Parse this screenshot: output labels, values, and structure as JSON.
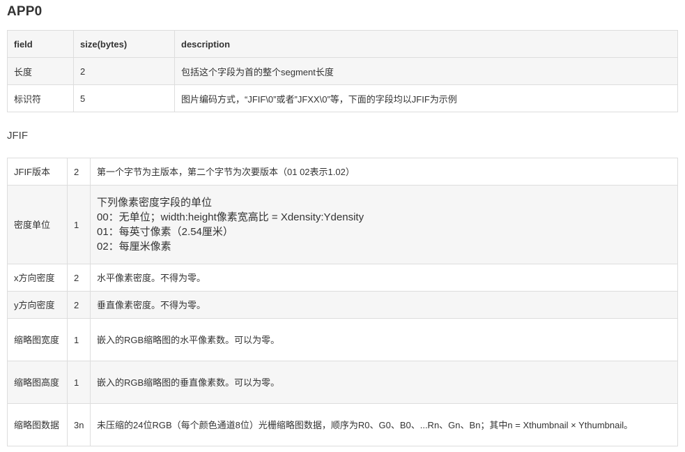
{
  "app0": {
    "title": "APP0",
    "headers": [
      "field",
      "size(bytes)",
      "description"
    ],
    "rows": [
      {
        "field": "长度",
        "size": "2",
        "description": "包括这个字段为首的整个segment长度"
      },
      {
        "field": "标识符",
        "size": "5",
        "description": "图片编码方式，“JFIF\\0”或者”JFXX\\0”等，下面的字段均以JFIF为示例"
      }
    ]
  },
  "jfif": {
    "title": "JFIF",
    "rows": [
      {
        "field": "JFIF版本",
        "size": "2",
        "description": "第一个字节为主版本，第二个字节为次要版本（01 02表示1.02）"
      },
      {
        "field": "密度单位",
        "size": "1",
        "description_lines": [
          "下列像素密度字段的单位",
          "00：无单位；width:height像素宽高比 = Xdensity:Ydensity",
          "01：每英寸像素（2.54厘米）",
          "02：每厘米像素"
        ]
      },
      {
        "field": "x方向密度",
        "size": "2",
        "description": "水平像素密度。不得为零。"
      },
      {
        "field": "y方向密度",
        "size": "2",
        "description": "垂直像素密度。不得为零。"
      },
      {
        "field": "缩略图宽度",
        "size": "1",
        "description": "嵌入的RGB缩略图的水平像素数。可以为零。"
      },
      {
        "field": "缩略图高度",
        "size": "1",
        "description": "嵌入的RGB缩略图的垂直像素数。可以为零。"
      },
      {
        "field": "缩略图数据",
        "size": "3n",
        "description": "未压缩的24位RGB（每个颜色通道8位）光栅缩略图数据，顺序为R0、G0、B0、...Rn、Gn、Bn；其中n = Xthumbnail × Ythumbnail。"
      }
    ]
  }
}
